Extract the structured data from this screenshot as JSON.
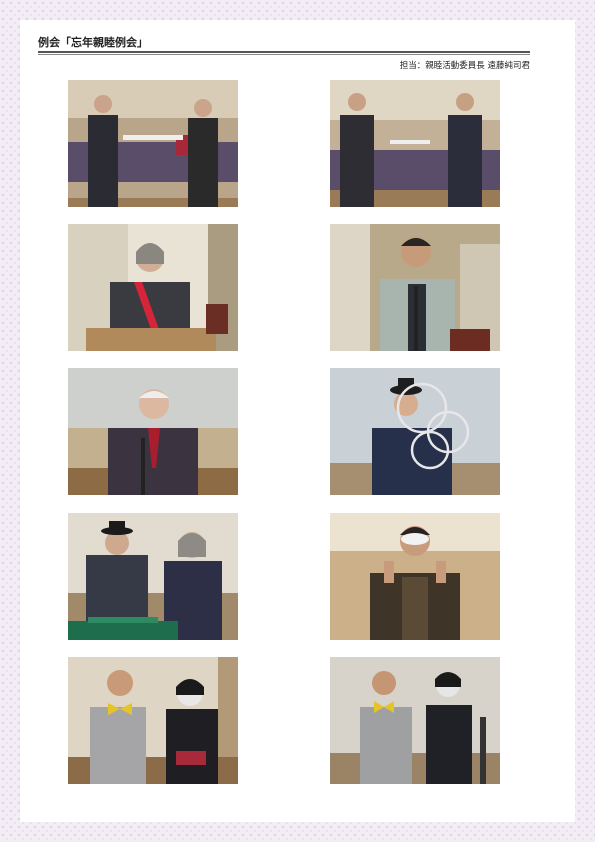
{
  "header": {
    "title": "例会「忘年親睦例会」",
    "credit": "担当：親睦活動委員長 遠藤純司君"
  },
  "photos": [
    {
      "id": "photo-1",
      "scene": "award handover at head table, two men"
    },
    {
      "id": "photo-2",
      "scene": "award handover at head table, two men in suits"
    },
    {
      "id": "photo-3",
      "scene": "woman with SAA sash speaking at lectern"
    },
    {
      "id": "photo-4",
      "scene": "man in light grey jacket speaking at microphone"
    },
    {
      "id": "photo-5",
      "scene": "older man in suit speaking at microphone"
    },
    {
      "id": "photo-6",
      "scene": "magician in hat performing with linking rings"
    },
    {
      "id": "photo-7",
      "scene": "magician performing card trick with woman"
    },
    {
      "id": "photo-8",
      "scene": "masked man making peace signs"
    },
    {
      "id": "photo-9",
      "scene": "man with yellow bow tie and masked performer"
    },
    {
      "id": "photo-10",
      "scene": "man with yellow bow tie and masked performer, second view"
    }
  ]
}
